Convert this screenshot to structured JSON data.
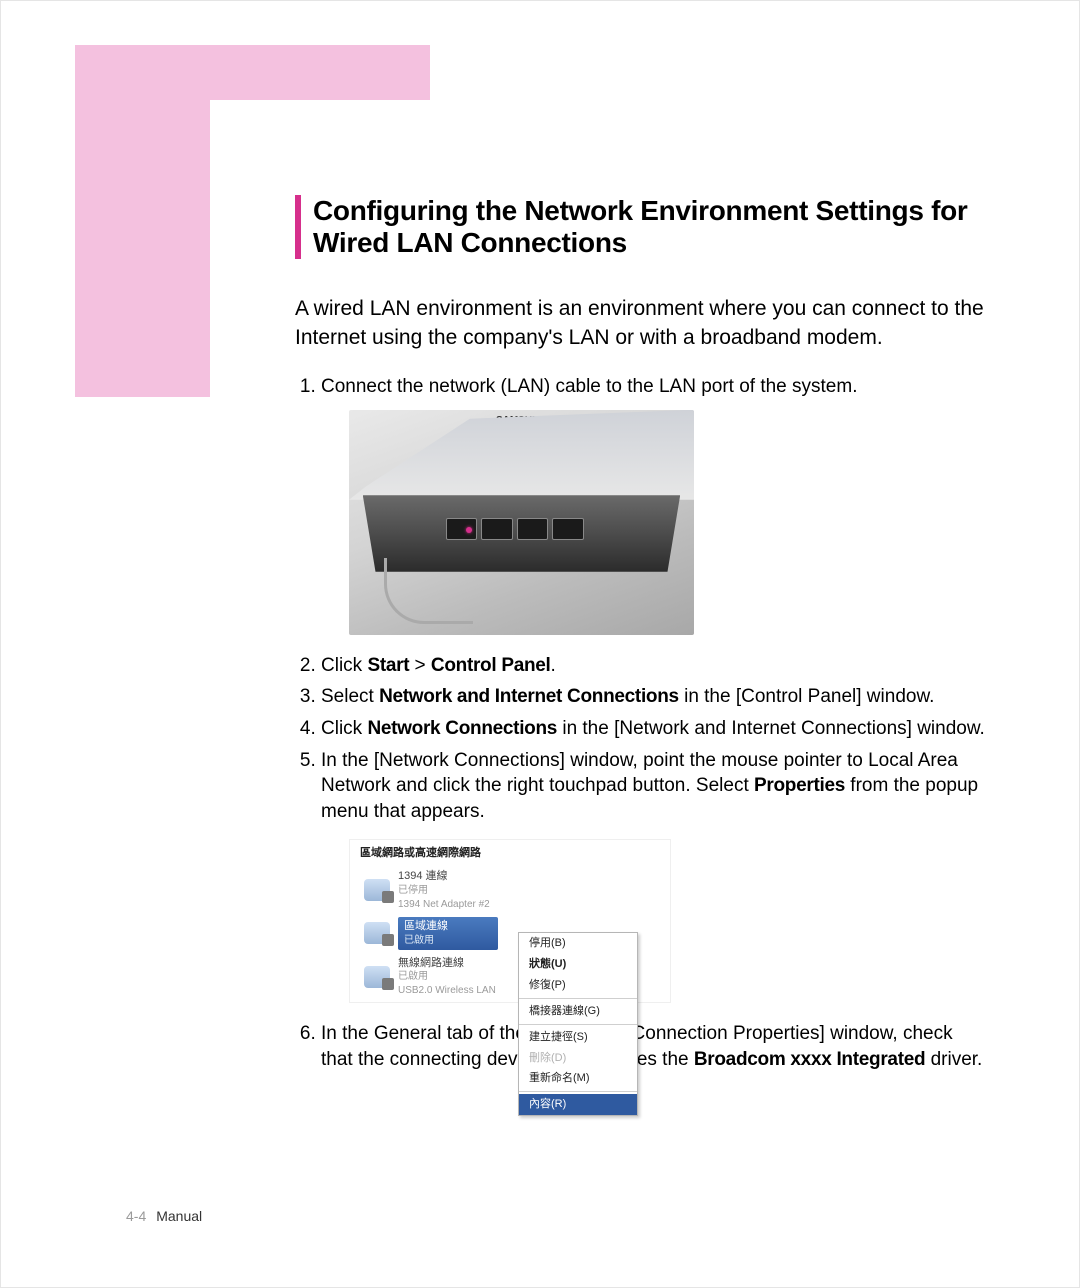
{
  "page": {
    "number": "4-4",
    "label": "Manual"
  },
  "heading": "Configuring the Network Environment Settings for Wired LAN Connections",
  "intro": "A wired LAN environment is an environment where you can connect to the Internet using the company's LAN or with a broadband modem.",
  "steps": {
    "s1": "Connect the network (LAN) cable to the LAN port of the system.",
    "s2_a": "Click ",
    "s2_b": "Start",
    "s2_c": " > ",
    "s2_d": "Control Panel",
    "s2_e": ".",
    "s3_a": "Select ",
    "s3_b": "Network and Internet Connections",
    "s3_c": " in the [Control Panel] window.",
    "s4_a": "Click ",
    "s4_b": "Network Connections",
    "s4_c": " in the [Network and Internet Connections] window.",
    "s5_a": "In the [Network Connections] window, point the mouse pointer to Local Area Network and click the right touchpad button. Select ",
    "s5_b": "Properties",
    "s5_c": " from the popup menu that appears.",
    "s6_a": "In the General tab of the [Local Area Connection Properties] window, check that the connecting device field includes the ",
    "s6_b": "Broadcom xxxx Integrated",
    "s6_c": " driver."
  },
  "laptop": {
    "brand": "SAMSUNG"
  },
  "netwin": {
    "header": "區域網路或高速網際網路",
    "i1": {
      "name": "1394 連線",
      "sub1": "已停用",
      "sub2": "1394 Net Adapter #2"
    },
    "i2": {
      "name": "區域連線",
      "sub1": "已啟用"
    },
    "i3": {
      "name": "無線網路連線",
      "sub1": "已啟用",
      "sub2": "USB2.0 Wireless LAN"
    },
    "menu": {
      "m1": "停用(B)",
      "m2": "狀態(U)",
      "m3": "修復(P)",
      "m4": "橋接器連線(G)",
      "m5": "建立捷徑(S)",
      "m6": "刪除(D)",
      "m7": "重新命名(M)",
      "m8": "內容(R)"
    }
  }
}
